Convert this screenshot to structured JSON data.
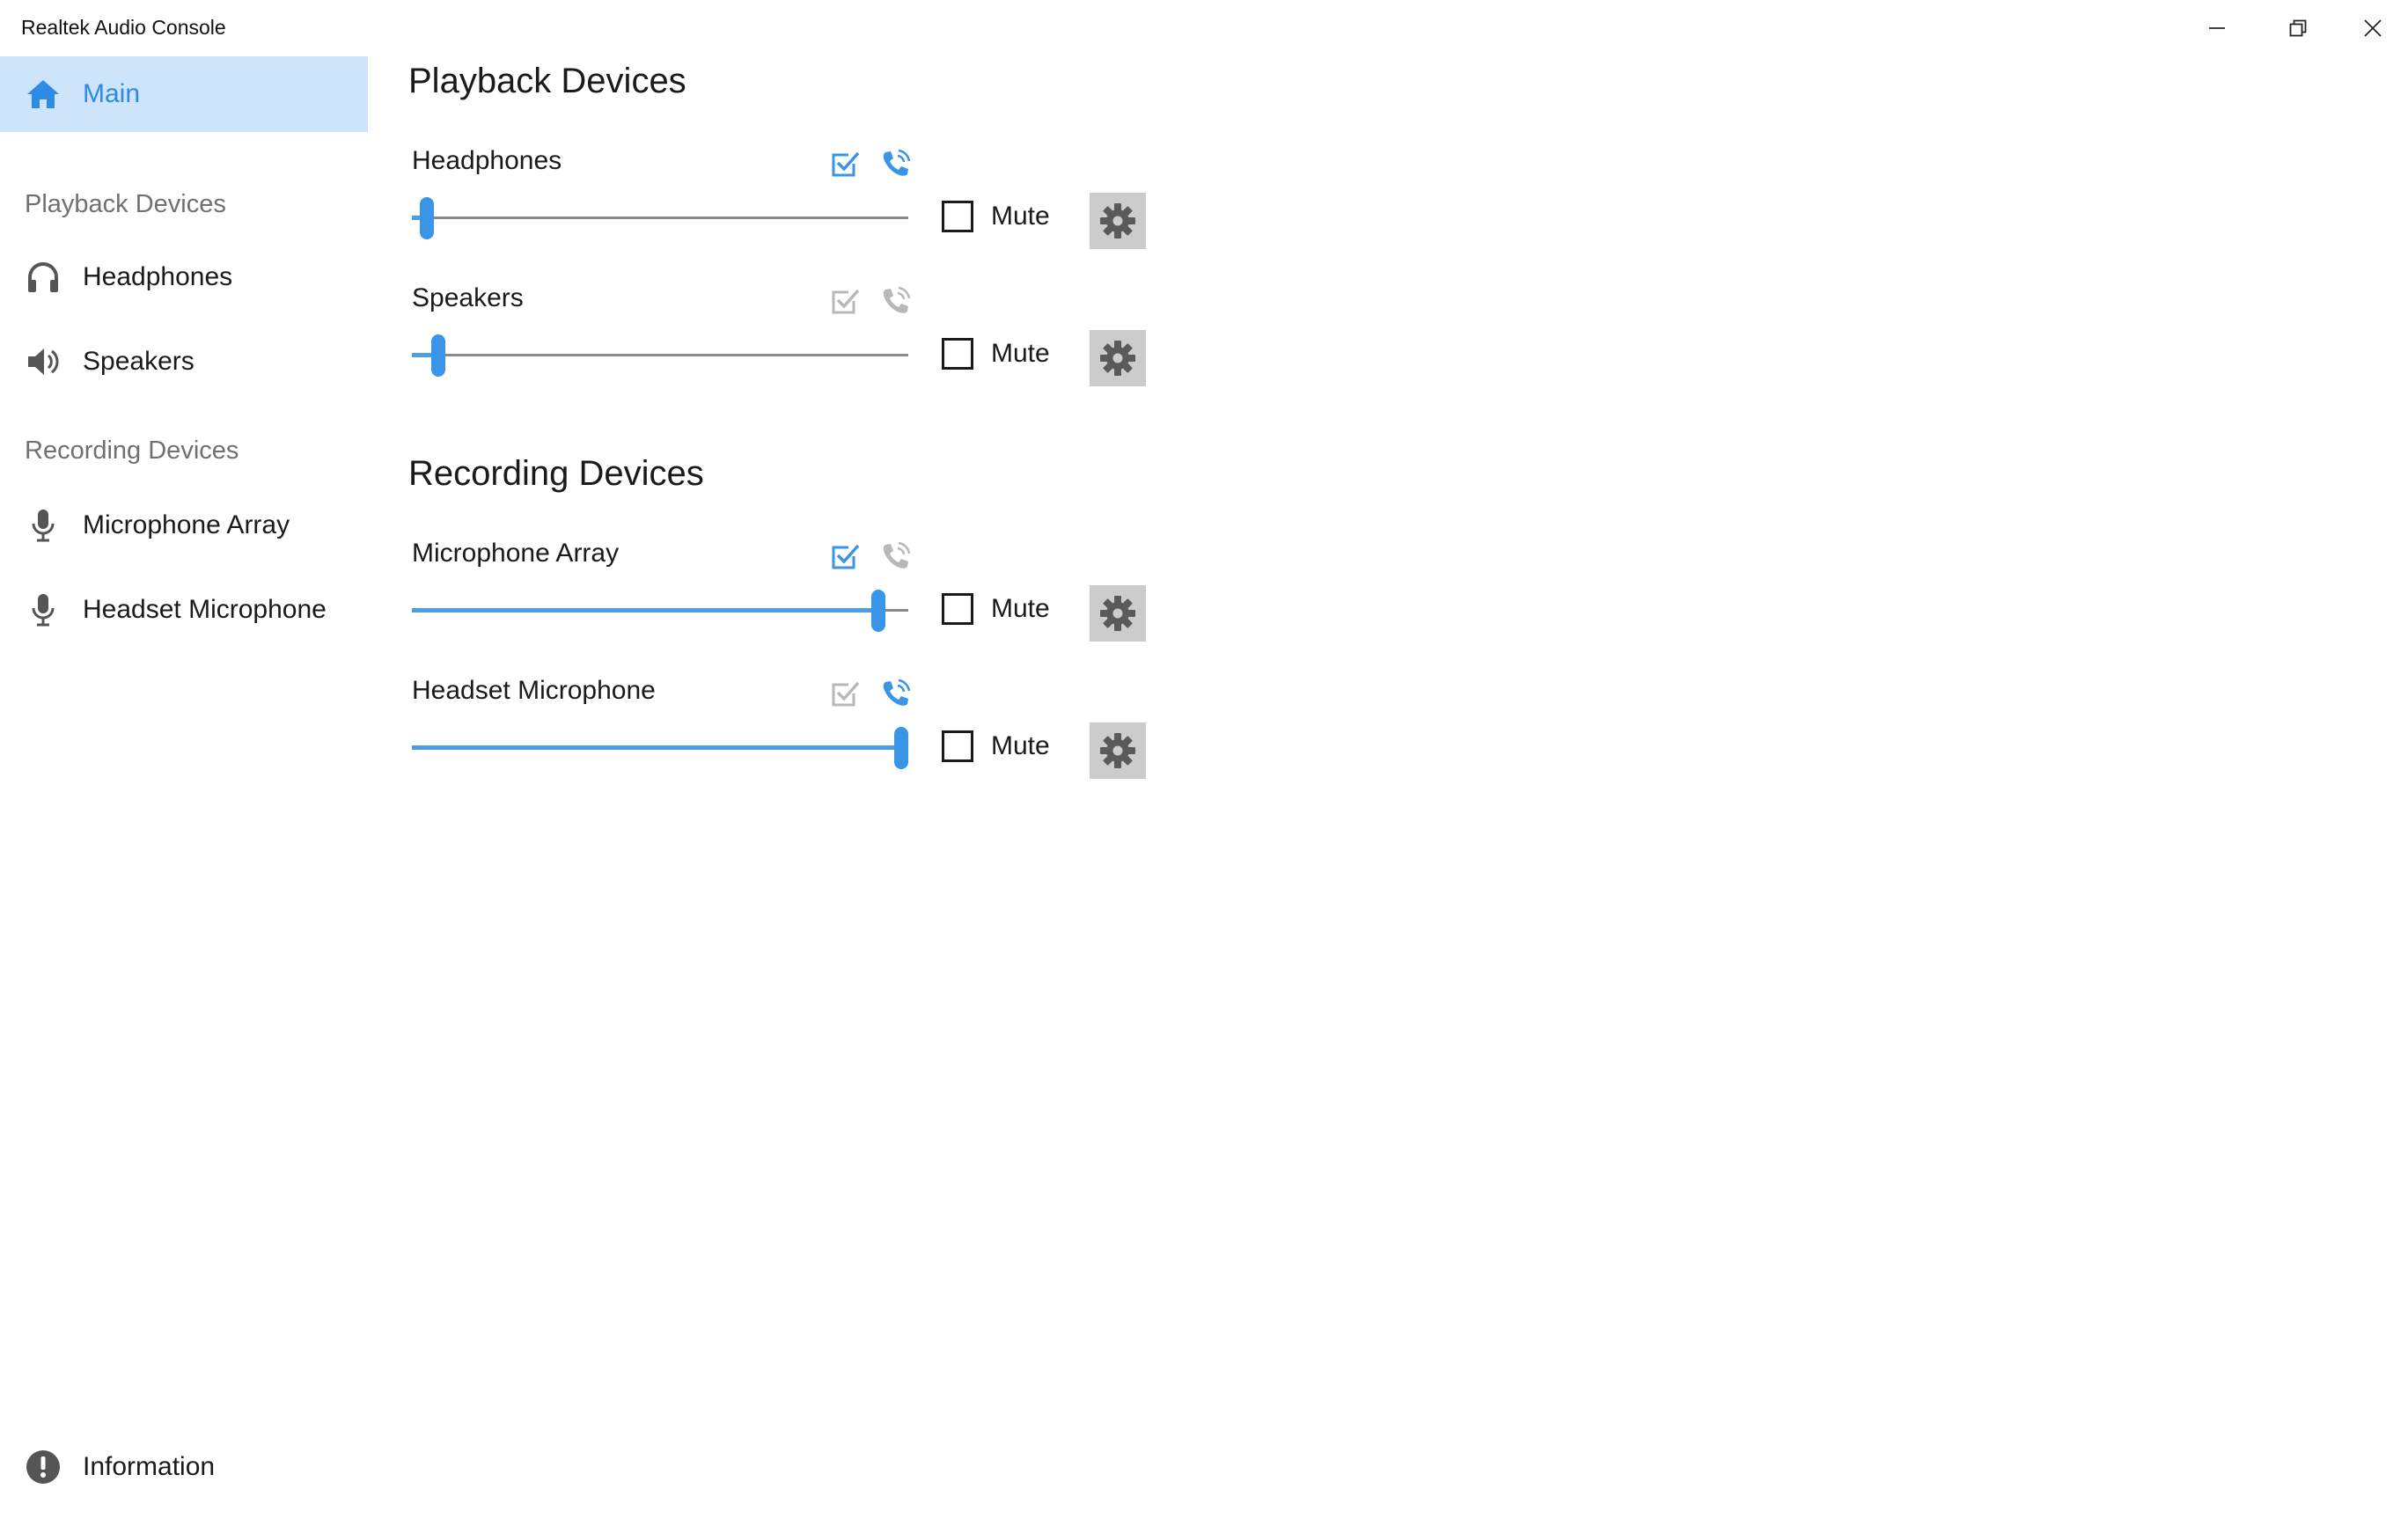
{
  "window": {
    "title": "Realtek Audio Console",
    "controls": [
      "minimize-icon",
      "restore-icon",
      "close-icon"
    ]
  },
  "sidebar": {
    "main": {
      "label": "Main",
      "icon": "home-icon"
    },
    "playback_header": "Playback Devices",
    "playback_items": [
      {
        "label": "Headphones",
        "icon": "headphones-icon"
      },
      {
        "label": "Speakers",
        "icon": "speaker-icon"
      }
    ],
    "recording_header": "Recording Devices",
    "recording_items": [
      {
        "label": "Microphone Array",
        "icon": "microphone-icon"
      },
      {
        "label": "Headset Microphone",
        "icon": "microphone-icon"
      }
    ],
    "info": {
      "label": "Information",
      "icon": "info-icon"
    }
  },
  "main": {
    "playback_title": "Playback Devices",
    "recording_title": "Recording Devices",
    "playback_devices": [
      {
        "name": "Headphones",
        "volume_fraction": 0.03,
        "default_device": true,
        "default_comm": true,
        "mute_label": "Mute",
        "muted": false
      },
      {
        "name": "Speakers",
        "volume_fraction": 0.05,
        "default_device": false,
        "default_comm": false,
        "mute_label": "Mute",
        "muted": false
      }
    ],
    "recording_devices": [
      {
        "name": "Microphone Array",
        "volume_fraction": 0.94,
        "default_device": true,
        "default_comm": false,
        "mute_label": "Mute",
        "muted": false
      },
      {
        "name": "Headset Microphone",
        "volume_fraction": 1.0,
        "default_device": false,
        "default_comm": true,
        "mute_label": "Mute",
        "muted": false
      }
    ]
  },
  "colors": {
    "accent": "#2d8be6",
    "selected_nav_bg": "#cde4fa",
    "inactive_icon": "#b8b8b8",
    "gear_bg": "#cccccc",
    "gear_icon": "#5a5a5a"
  }
}
